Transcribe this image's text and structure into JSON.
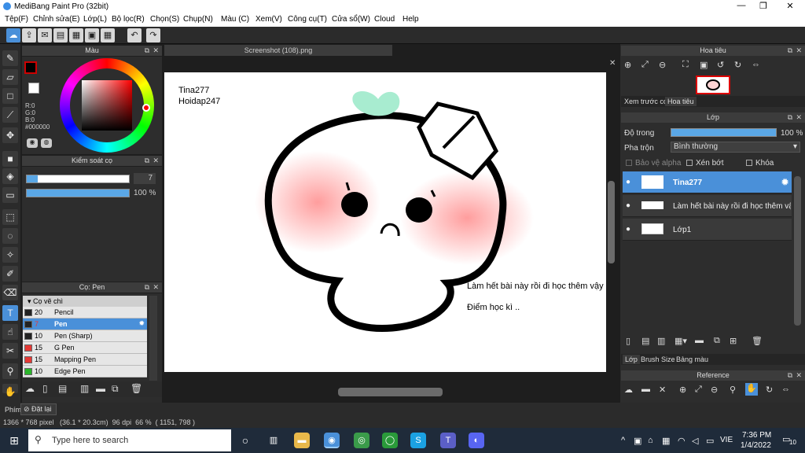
{
  "app": {
    "title": "MediBang Paint Pro (32bit)"
  },
  "menu": [
    "Tệp(F)",
    "Chỉnh sửa(E)",
    "Lớp(L)",
    "Bộ lọc(R)",
    "Chọn(S)",
    "Chụp(N)",
    "Màu (C)",
    "Xem(V)",
    "Công cụ(T)",
    "Cửa sổ(W)",
    "Cloud",
    "Help"
  ],
  "color_panel": {
    "title": "Màu",
    "r": "R:0",
    "g": "G:0",
    "b": "B:0",
    "hex": "#000000"
  },
  "brush_control": {
    "title": "Kiểm soát cọ",
    "size": "7",
    "opacity": "100 %"
  },
  "brush_panel": {
    "title": "Cọ: Pen",
    "group": "Cọ vẽ chì",
    "items": [
      {
        "size": "20",
        "name": "Pencil",
        "color": "#222222"
      },
      {
        "size": "7",
        "name": "Pen",
        "color": "#222222"
      },
      {
        "size": "10",
        "name": "Pen (Sharp)",
        "color": "#222222"
      },
      {
        "size": "15",
        "name": "G Pen",
        "color": "#e53935"
      },
      {
        "size": "15",
        "name": "Mapping Pen",
        "color": "#e53935"
      },
      {
        "size": "10",
        "name": "Edge Pen",
        "color": "#2bb52b"
      }
    ]
  },
  "document": {
    "tab": "Screenshot (108).png",
    "text1": "Tina277",
    "text2": "Hoidap247",
    "text3": "Làm hết bài này rồi đi học thêm vậy",
    "text4": "Điểm học kì .."
  },
  "navigator": {
    "title": "Hoa tiêu",
    "tab_preview": "Xem trước cọ",
    "tab_nav": "Hoa tiêu"
  },
  "layers": {
    "title": "Lớp",
    "opacity_label": "Độ trong",
    "opacity": "100 %",
    "blend_label": "Pha trộn",
    "blend": "Bình thường",
    "protect_alpha": "Bảo vệ alpha",
    "clipping": "Xén bớt",
    "lock": "Khóa",
    "items": [
      {
        "name": "Tina277"
      },
      {
        "name": "Làm hết bài này rồi đi học thêm vậy"
      },
      {
        "name": "Lớp1"
      }
    ],
    "bottom_tabs": [
      "Lớp",
      "Brush Size",
      "Bảng màu"
    ]
  },
  "reference": {
    "title": "Reference"
  },
  "bottombar": {
    "hotkey": "Phím",
    "reset": "Đặt lại"
  },
  "status": {
    "info": "1366 * 768 pixel   (36.1 * 20.3cm)  96 dpi  66 %  ( 1151, 798 )"
  },
  "taskbar": {
    "search_placeholder": "Type here to search",
    "time": "7:36 PM",
    "date": "1/4/2022",
    "lang": "VIE",
    "notif": "10"
  }
}
